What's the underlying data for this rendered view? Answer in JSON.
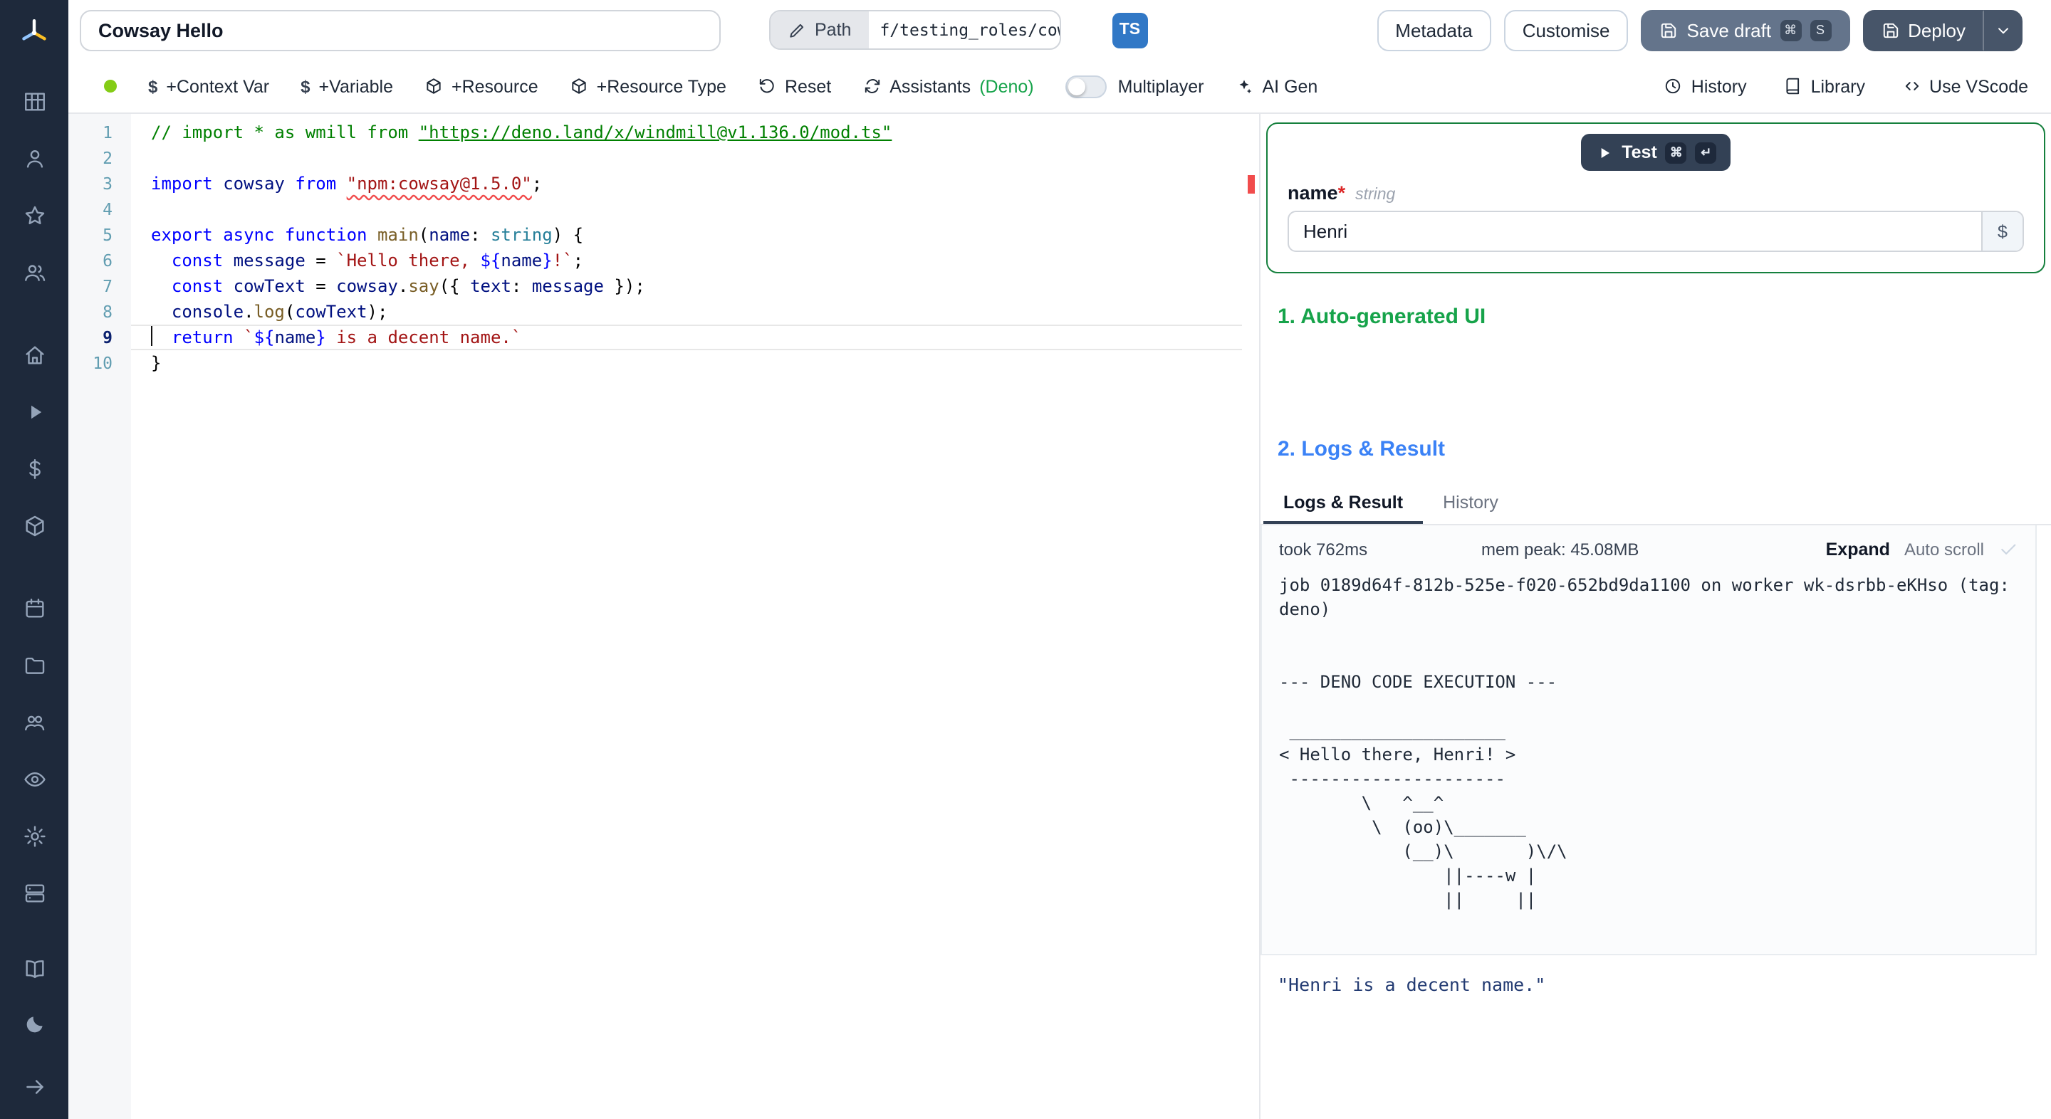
{
  "topbar": {
    "script_name": "Cowsay Hello",
    "path_label": "Path",
    "path_value": "f/testing_roles/cowsa",
    "lang_badge": "TS",
    "metadata": "Metadata",
    "customise": "Customise",
    "save_draft": "Save draft",
    "save_kbd1": "⌘",
    "save_kbd2": "S",
    "deploy": "Deploy"
  },
  "toolbar": {
    "context_var": "+Context Var",
    "variable": "+Variable",
    "resource": "+Resource",
    "resource_type": "+Resource Type",
    "reset": "Reset",
    "assistants": "Assistants",
    "assistants_suffix": "(Deno)",
    "multiplayer": "Multiplayer",
    "ai_gen": "AI Gen",
    "history": "History",
    "library": "Library",
    "use_vscode": "Use VScode",
    "dollar_glyph": "$"
  },
  "sidebar": {
    "nav_groups": [
      [
        "grid",
        "user",
        "star",
        "users"
      ],
      [
        "home",
        "play",
        "dollar",
        "cube"
      ],
      [
        "calendar",
        "folder",
        "group",
        "eye",
        "gear",
        "server"
      ]
    ],
    "bottom": [
      "book",
      "moon"
    ],
    "footer": [
      "arrow-right"
    ]
  },
  "editor": {
    "current_line": 9,
    "lines": [
      [
        {
          "c": "cm",
          "t": "// import * as wmill from "
        },
        {
          "c": "cml",
          "t": "\"https://deno.land/x/windmill@v1.136.0/mod.ts\""
        }
      ],
      [],
      [
        {
          "c": "kw",
          "t": "import"
        },
        {
          "c": "pl",
          "t": " "
        },
        {
          "c": "vr",
          "t": "cowsay"
        },
        {
          "c": "pl",
          "t": " "
        },
        {
          "c": "kw",
          "t": "from"
        },
        {
          "c": "pl",
          "t": " "
        },
        {
          "c": "strerr",
          "t": "\"npm:cowsay@1.5.0\""
        },
        {
          "c": "pl",
          "t": ";"
        }
      ],
      [],
      [
        {
          "c": "kw",
          "t": "export"
        },
        {
          "c": "pl",
          "t": " "
        },
        {
          "c": "kw",
          "t": "async"
        },
        {
          "c": "pl",
          "t": " "
        },
        {
          "c": "kw",
          "t": "function"
        },
        {
          "c": "pl",
          "t": " "
        },
        {
          "c": "fn",
          "t": "main"
        },
        {
          "c": "pl",
          "t": "("
        },
        {
          "c": "vr",
          "t": "name"
        },
        {
          "c": "pl",
          "t": ": "
        },
        {
          "c": "ty",
          "t": "string"
        },
        {
          "c": "pl",
          "t": ") {"
        }
      ],
      [
        {
          "c": "pl",
          "t": "  "
        },
        {
          "c": "kw",
          "t": "const"
        },
        {
          "c": "pl",
          "t": " "
        },
        {
          "c": "vr",
          "t": "message"
        },
        {
          "c": "pl",
          "t": " = "
        },
        {
          "c": "str",
          "t": "`Hello there, "
        },
        {
          "c": "kw",
          "t": "${"
        },
        {
          "c": "vr",
          "t": "name"
        },
        {
          "c": "kw",
          "t": "}"
        },
        {
          "c": "str",
          "t": "!`"
        },
        {
          "c": "pl",
          "t": ";"
        }
      ],
      [
        {
          "c": "pl",
          "t": "  "
        },
        {
          "c": "kw",
          "t": "const"
        },
        {
          "c": "pl",
          "t": " "
        },
        {
          "c": "vr",
          "t": "cowText"
        },
        {
          "c": "pl",
          "t": " = "
        },
        {
          "c": "vr",
          "t": "cowsay"
        },
        {
          "c": "pl",
          "t": "."
        },
        {
          "c": "fn",
          "t": "say"
        },
        {
          "c": "pl",
          "t": "({ "
        },
        {
          "c": "vr",
          "t": "text"
        },
        {
          "c": "pl",
          "t": ": "
        },
        {
          "c": "vr",
          "t": "message"
        },
        {
          "c": "pl",
          "t": " });"
        }
      ],
      [
        {
          "c": "pl",
          "t": "  "
        },
        {
          "c": "vr",
          "t": "console"
        },
        {
          "c": "pl",
          "t": "."
        },
        {
          "c": "fn",
          "t": "log"
        },
        {
          "c": "pl",
          "t": "("
        },
        {
          "c": "vr",
          "t": "cowText"
        },
        {
          "c": "pl",
          "t": ");"
        }
      ],
      [
        {
          "c": "pl",
          "t": "  "
        },
        {
          "c": "kw",
          "t": "return"
        },
        {
          "c": "pl",
          "t": " "
        },
        {
          "c": "str",
          "t": "`"
        },
        {
          "c": "kw",
          "t": "${"
        },
        {
          "c": "vr",
          "t": "name"
        },
        {
          "c": "kw",
          "t": "}"
        },
        {
          "c": "str",
          "t": " is a decent name.`"
        }
      ],
      [
        {
          "c": "pl",
          "t": "}"
        }
      ]
    ]
  },
  "panel": {
    "test": "Test",
    "test_kbd1": "⌘",
    "test_kbd2": "↵",
    "arg_name": "name",
    "required": "*",
    "arg_type": "string",
    "arg_value": "Henri",
    "var_picker": "$",
    "section1": "1. Auto-generated UI",
    "section2": "2. Logs & Result",
    "tabs": [
      "Logs & Result",
      "History"
    ],
    "took": "took 762ms",
    "mem": "mem peak: 45.08MB",
    "expand": "Expand",
    "autoscroll": "Auto scroll",
    "log": "job 0189d64f-812b-525e-f020-652bd9da1100 on worker wk-dsrbb-eKHso (tag: deno)\n\n\n--- DENO CODE EXECUTION ---\n\n _____________________\n< Hello there, Henri! >\n ---------------------\n        \\   ^__^\n         \\  (oo)\\_______\n            (__)\\       )\\/\\\n                ||----w |\n                ||     ||",
    "result": "\"Henri is a decent name.\""
  }
}
